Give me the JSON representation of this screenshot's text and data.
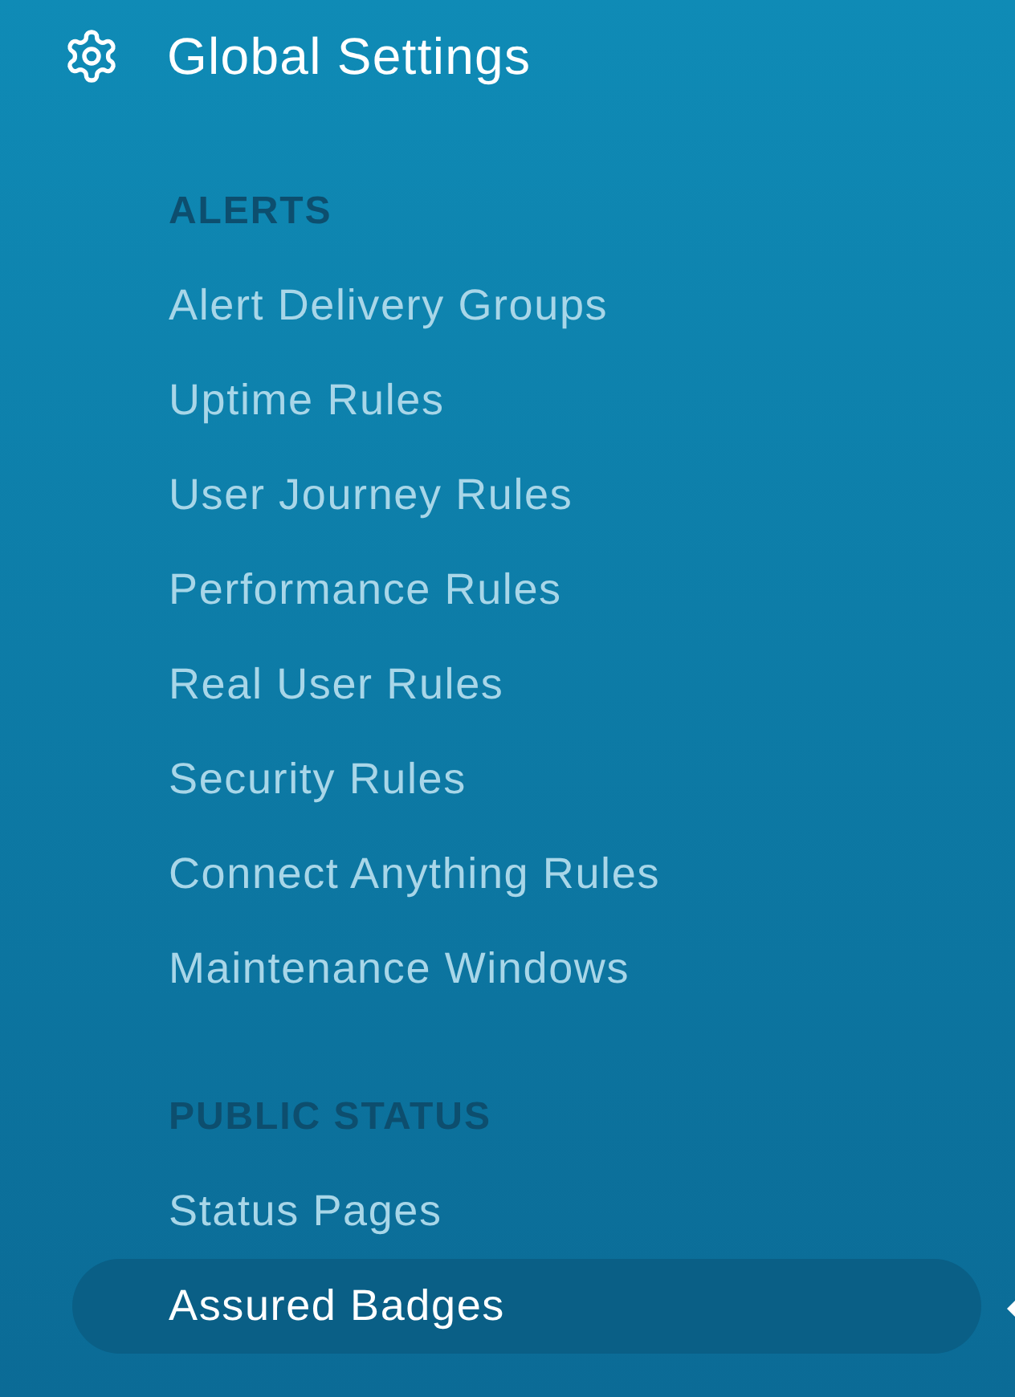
{
  "title": "Global Settings",
  "sections": [
    {
      "heading": "ALERTS",
      "items": [
        {
          "label": "Alert Delivery Groups",
          "selected": false
        },
        {
          "label": "Uptime Rules",
          "selected": false
        },
        {
          "label": "User Journey Rules",
          "selected": false
        },
        {
          "label": "Performance Rules",
          "selected": false
        },
        {
          "label": "Real User Rules",
          "selected": false
        },
        {
          "label": "Security Rules",
          "selected": false
        },
        {
          "label": "Connect Anything Rules",
          "selected": false
        },
        {
          "label": "Maintenance Windows",
          "selected": false
        }
      ]
    },
    {
      "heading": "PUBLIC STATUS",
      "items": [
        {
          "label": "Status Pages",
          "selected": false
        },
        {
          "label": "Assured Badges",
          "selected": true
        }
      ]
    }
  ]
}
